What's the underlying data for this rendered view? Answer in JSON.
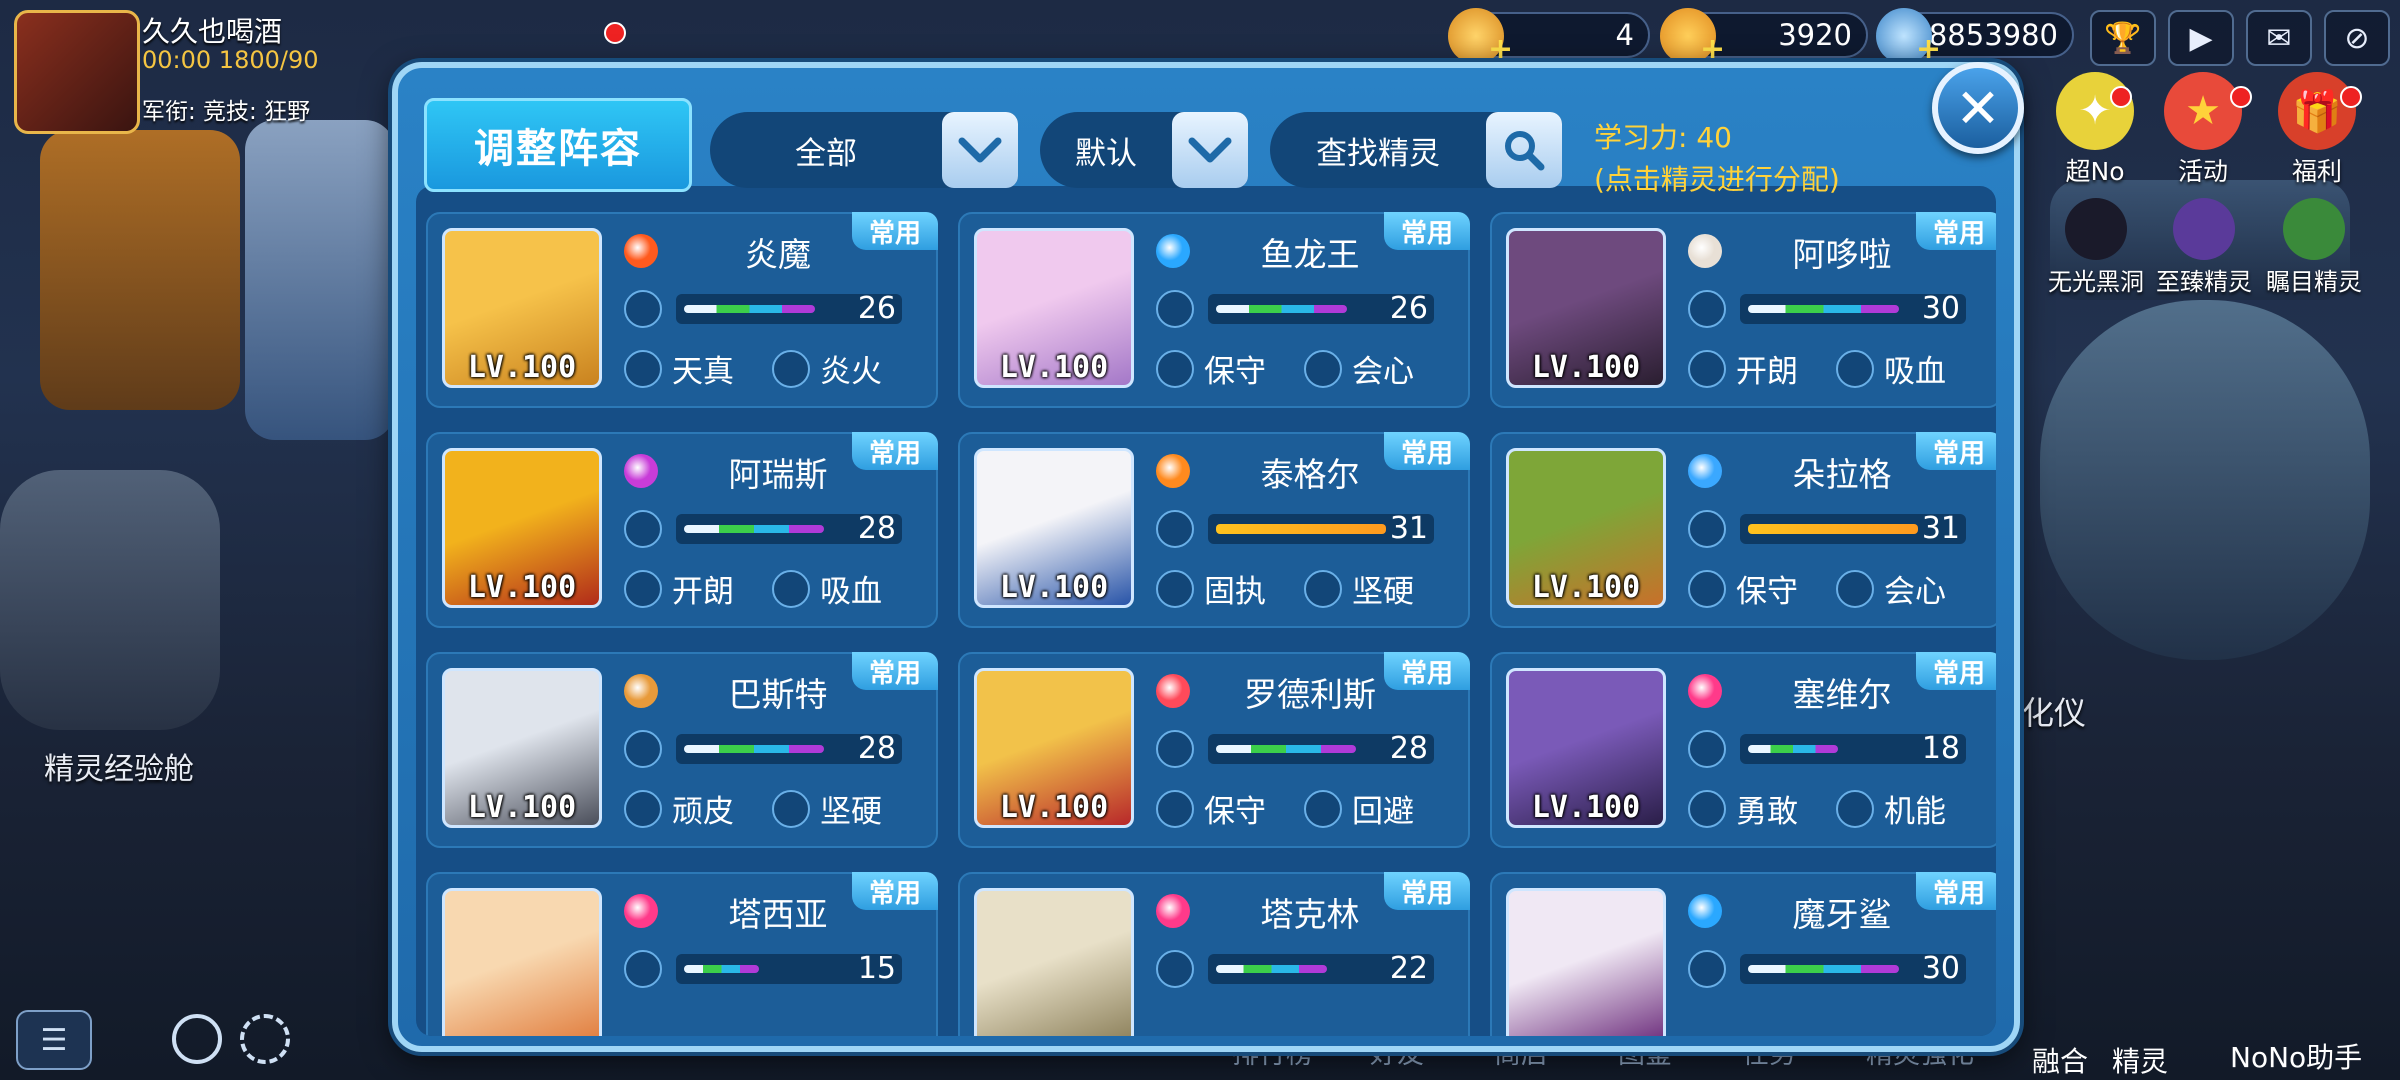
{
  "player": {
    "name": "久久也喝酒",
    "energy": "00:00 1800/90",
    "rank_text": "军衔:  竞技:  狂野"
  },
  "resources": [
    {
      "value": "4"
    },
    {
      "value": "3920"
    },
    {
      "value": "8853980"
    }
  ],
  "side_right": [
    {
      "label": "超No"
    },
    {
      "label": "活动"
    },
    {
      "label": "福利"
    },
    {
      "label": "无光黑洞"
    },
    {
      "label": "至臻精灵"
    },
    {
      "label": "瞩目精灵"
    }
  ],
  "background": {
    "left_label": "精灵经验舱",
    "right_label": "化仪",
    "nono": "NoNo助手",
    "sprite": "精灵",
    "fusion": "融合"
  },
  "bottom_nav": [
    "排行榜",
    "好友",
    "商店",
    "图鉴",
    "任务",
    "精灵强化"
  ],
  "modal": {
    "title": "调整阵容",
    "filter_all": "全部",
    "filter_default": "默认",
    "search_label": "查找精灵",
    "learning": "学习力:  40",
    "learning_hint": "(点击精灵进行分配)"
  },
  "cards": [
    {
      "name": "炎魔",
      "level": "LV.100",
      "badge": "常用",
      "value": "26",
      "trait1": "天真",
      "trait2": "炎火",
      "elem_color": "#ff5a1e",
      "portrait": [
        "#f6c24a",
        "#c9821f"
      ],
      "bar_type": "multi",
      "fill": 0.84
    },
    {
      "name": "鱼龙王",
      "level": "LV.100",
      "badge": "常用",
      "value": "26",
      "trait1": "保守",
      "trait2": "会心",
      "elem_color": "#2aa8ff",
      "portrait": [
        "#f0c9ee",
        "#a478c8"
      ],
      "bar_type": "multi",
      "fill": 0.84
    },
    {
      "name": "阿哆啦",
      "level": "LV.100",
      "badge": "常用",
      "value": "30",
      "trait1": "开朗",
      "trait2": "吸血",
      "elem_color": "#e8e0d6",
      "portrait": [
        "#6e4a7e",
        "#2a1e30"
      ],
      "bar_type": "multi",
      "fill": 0.97
    },
    {
      "name": "阿瑞斯",
      "level": "LV.100",
      "badge": "常用",
      "value": "28",
      "trait1": "开朗",
      "trait2": "吸血",
      "elem_color": "#c83cd8",
      "portrait": [
        "#f2b21c",
        "#b12b1a"
      ],
      "bar_type": "multi",
      "fill": 0.9
    },
    {
      "name": "泰格尔",
      "level": "LV.100",
      "badge": "常用",
      "value": "31",
      "trait1": "固执",
      "trait2": "坚硬",
      "elem_color": "#ff8a1e",
      "portrait": [
        "#f4f4f8",
        "#2854a8"
      ],
      "bar_type": "gold",
      "fill": 1.0
    },
    {
      "name": "朵拉格",
      "level": "LV.100",
      "badge": "常用",
      "value": "31",
      "trait1": "保守",
      "trait2": "会心",
      "elem_color": "#3aa8ff",
      "portrait": [
        "#7ea638",
        "#c8702a"
      ],
      "bar_type": "gold",
      "fill": 1.0
    },
    {
      "name": "巴斯特",
      "level": "LV.100",
      "badge": "常用",
      "value": "28",
      "trait1": "顽皮",
      "trait2": "坚硬",
      "elem_color": "#e89a3a",
      "portrait": [
        "#dfe4ec",
        "#4a4e5a"
      ],
      "bar_type": "multi",
      "fill": 0.9
    },
    {
      "name": "罗德利斯",
      "level": "LV.100",
      "badge": "常用",
      "value": "28",
      "trait1": "保守",
      "trait2": "回避",
      "elem_color": "#ff4a5a",
      "portrait": [
        "#f2c24a",
        "#b8282a"
      ],
      "bar_type": "multi",
      "fill": 0.9
    },
    {
      "name": "塞维尔",
      "level": "LV.100",
      "badge": "常用",
      "value": "18",
      "trait1": "勇敢",
      "trait2": "机能",
      "elem_color": "#ff3a8a",
      "portrait": [
        "#7a5ab8",
        "#2a1e48"
      ],
      "bar_type": "multi",
      "fill": 0.58
    },
    {
      "name": "塔西亚",
      "level": "",
      "badge": "常用",
      "value": "15",
      "trait1": "",
      "trait2": "",
      "elem_color": "#ff3a8a",
      "portrait": [
        "#f8d8b0",
        "#e07a3a"
      ],
      "bar_type": "multi",
      "fill": 0.48
    },
    {
      "name": "塔克林",
      "level": "",
      "badge": "常用",
      "value": "22",
      "trait1": "",
      "trait2": "",
      "elem_color": "#ff3a8a",
      "portrait": [
        "#e8e0c8",
        "#8a7e58"
      ],
      "bar_type": "multi",
      "fill": 0.71
    },
    {
      "name": "魔牙鲨",
      "level": "",
      "badge": "常用",
      "value": "30",
      "trait1": "",
      "trait2": "",
      "elem_color": "#2aa8ff",
      "portrait": [
        "#f0e8f4",
        "#6a2a7a"
      ],
      "bar_type": "multi",
      "fill": 0.97
    }
  ],
  "colors": {
    "accent": "#2fc6f5",
    "highlight": "#ffd23a",
    "badge": "#2f9ee0"
  }
}
